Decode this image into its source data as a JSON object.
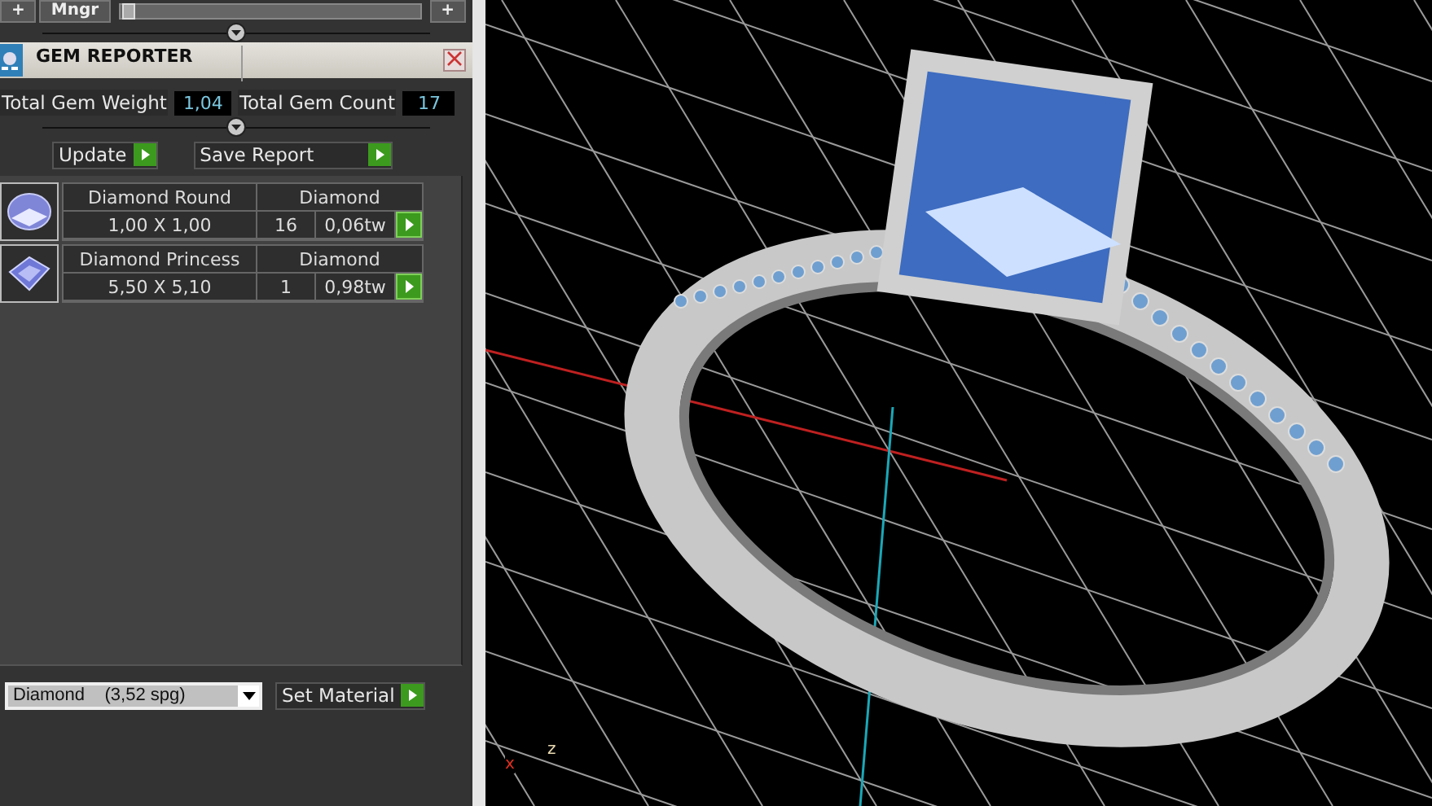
{
  "toolbar": {
    "buttons": [
      "+",
      "Mngr"
    ],
    "slider": {
      "level": 0.03
    },
    "end_button": "+"
  },
  "panel": {
    "title": "GEM REPORTER",
    "totals": [
      {
        "label": "Total Gem Weight",
        "value": "1,04"
      },
      {
        "label": "Total Gem Count",
        "value": "17"
      }
    ],
    "actions": [
      "Update",
      "Save Report"
    ],
    "gems": [
      {
        "kind": "round",
        "name": "Diamond Round",
        "material": "Diamond",
        "size": "1,00 X 1,00",
        "count": "16",
        "weight": "0,06tw"
      },
      {
        "kind": "princess",
        "name": "Diamond Princess",
        "material": "Diamond",
        "size": "5,50 X 5,10",
        "count": "1",
        "weight": "0,98tw"
      }
    ],
    "material_select": {
      "value": "Diamond    (3,52 spg)"
    },
    "set_button": "Set Material"
  },
  "viewport": {
    "axes": [
      {
        "kind": "x",
        "label": "x"
      },
      {
        "kind": "z",
        "label": "z"
      }
    ]
  }
}
